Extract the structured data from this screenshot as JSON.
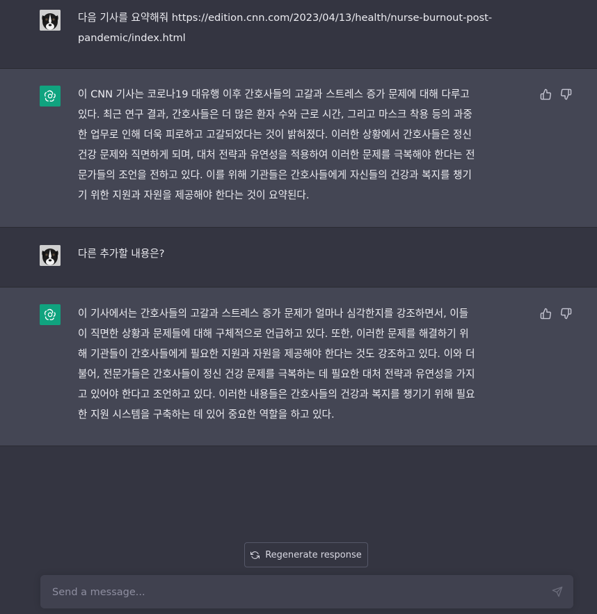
{
  "conversation": [
    {
      "role": "user",
      "text": "다음 기사를 요약해줘 https://edition.cnn.com/2023/04/13/health/nurse-burnout-post-\npandemic/index.html"
    },
    {
      "role": "assistant",
      "text": "이 CNN 기사는 코로나19 대유행 이후 간호사들의 고갈과 스트레스 증가 문제에 대해 다루고\n있다. 최근 연구 결과, 간호사들은 더 많은 환자 수와 근로 시간, 그리고 마스크 착용 등의 과중\n한 업무로 인해 더욱 피로하고 고갈되었다는 것이 밝혀졌다. 이러한 상황에서 간호사들은 정신\n건강 문제와 직면하게 되며, 대처 전략과 유연성을 적용하여 이러한 문제를 극복해야 한다는 전\n문가들의 조언을 전하고 있다. 이를 위해 기관들은 간호사들에게 자신들의 건강과 복지를 챙기\n기 위한 지원과 자원을 제공해야 한다는 것이 요약된다."
    },
    {
      "role": "user",
      "text": "다른 추가할 내용은?"
    },
    {
      "role": "assistant",
      "text": "이 기사에서는 간호사들의 고갈과 스트레스 증가 문제가 얼마나 심각한지를 강조하면서, 이들\n이 직면한 상황과 문제들에 대해 구체적으로 언급하고 있다. 또한, 이러한 문제를 해결하기 위\n해 기관들이 간호사들에게 필요한 지원과 자원을 제공해야 한다는 것도 강조하고 있다. 이와 더\n불어, 전문가들은 간호사들이 정신 건강 문제를 극복하는 데 필요한 대처 전략과 유연성을 가지\n고 있어야 한다고 조언하고 있다. 이러한 내용들은 간호사들의 건강과 복지를 챙기기 위해 필요\n한 지원 시스템을 구축하는 데 있어 중요한 역할을 하고 있다."
    }
  ],
  "regenerate_label": "Regenerate response",
  "input": {
    "placeholder": "Send a message...",
    "value": ""
  },
  "icons": {
    "user_avatar": "dog-avatar-icon",
    "assistant_avatar": "openai-logo-icon",
    "thumbs_up": "thumbs-up-icon",
    "thumbs_down": "thumbs-down-icon",
    "regenerate": "refresh-icon",
    "send": "send-icon"
  },
  "colors": {
    "background": "#343541",
    "assistant_row": "#444654",
    "input_bg": "#40414f",
    "assistant_avatar": "#10a37f",
    "text": "#ececf1"
  }
}
